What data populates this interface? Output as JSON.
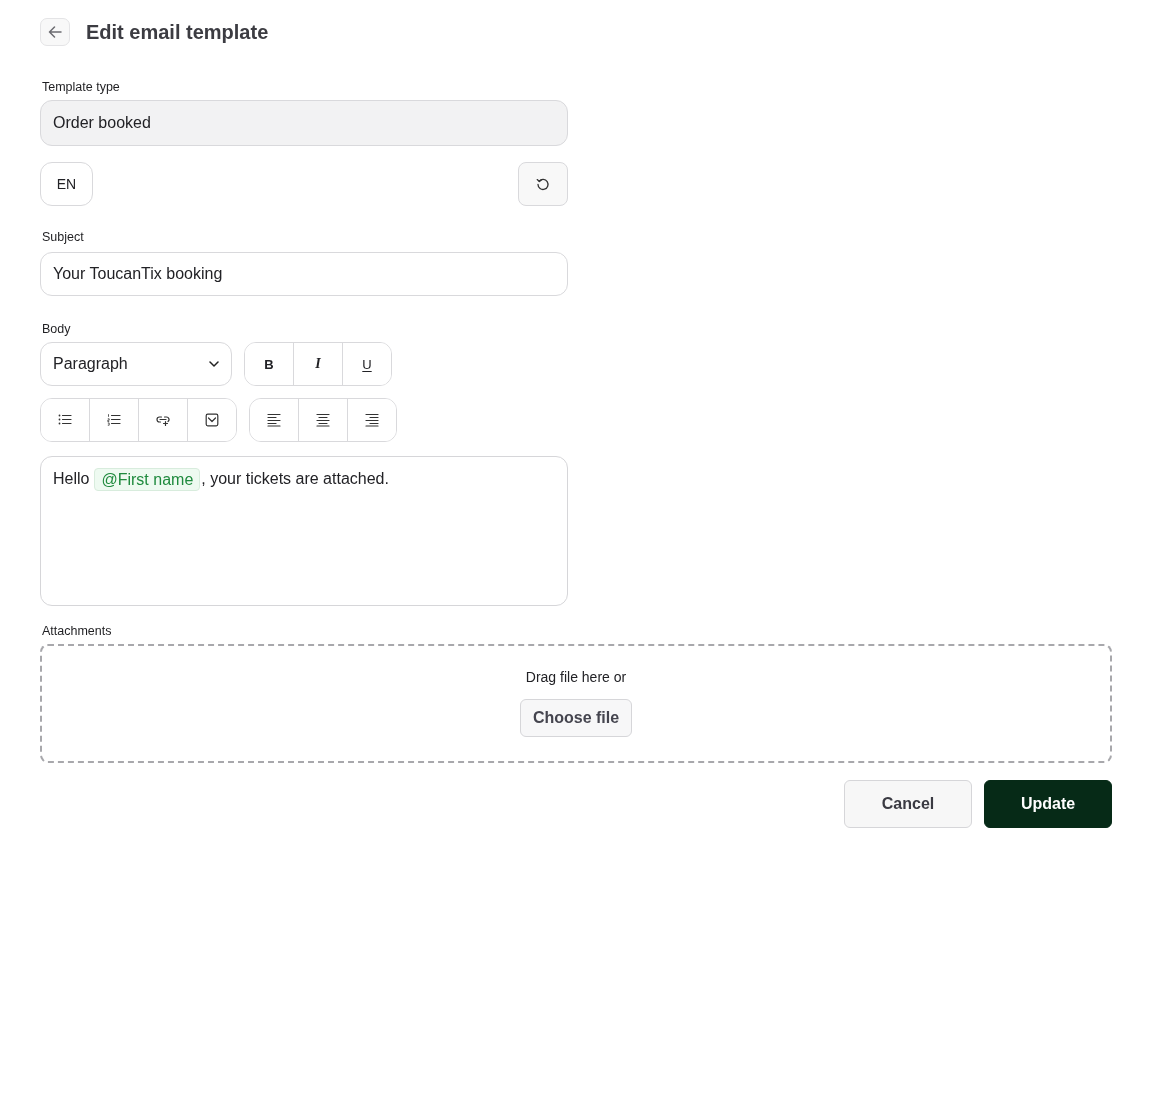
{
  "header": {
    "title": "Edit email template"
  },
  "template_type": {
    "label": "Template type",
    "value": "Order booked",
    "disabled": true
  },
  "language": {
    "label": "EN"
  },
  "subject": {
    "label": "Subject",
    "value": "Your ToucanTix booking"
  },
  "body": {
    "label": "Body",
    "block_format": "Paragraph",
    "format_buttons": [
      {
        "label": "B"
      },
      {
        "label": "I"
      },
      {
        "label": "U"
      }
    ],
    "content": [
      {
        "kind": "text",
        "text": "Hello"
      },
      {
        "kind": "mention",
        "text": "@First name"
      },
      {
        "kind": "text",
        "text": ", your tickets are attached."
      }
    ]
  },
  "attachments": {
    "label": "Attachments",
    "prompt": "Drag file here or",
    "button": "Choose file"
  },
  "actions": [
    {
      "kind": "secondary",
      "label": "Cancel"
    },
    {
      "kind": "primary",
      "label": "Update"
    }
  ]
}
